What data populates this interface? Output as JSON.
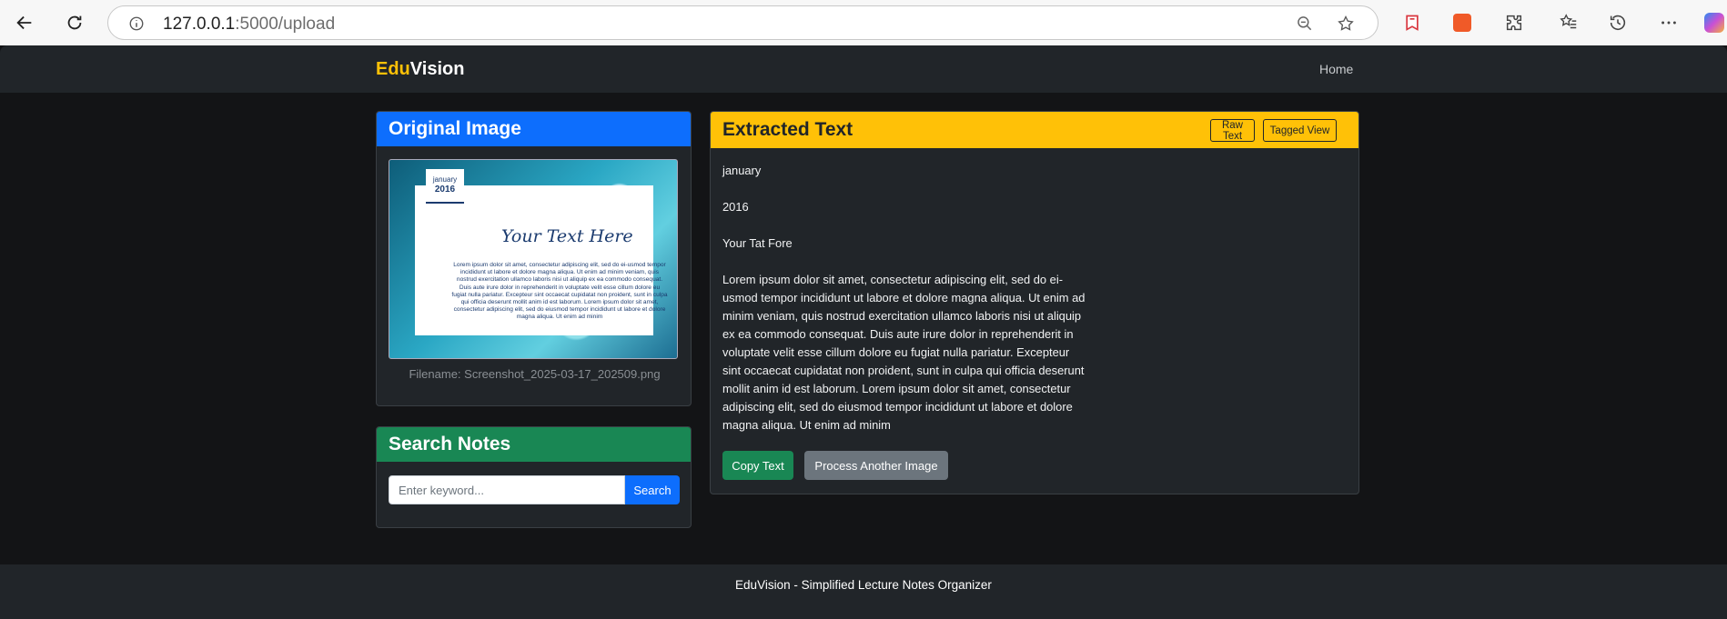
{
  "browser": {
    "url_host": "127.0.0.1",
    "url_path": ":5000/upload"
  },
  "nav": {
    "brand_part1": "Edu",
    "brand_part2": "Vision",
    "home": "Home"
  },
  "original": {
    "title": "Original Image",
    "filename": "Filename: Screenshot_2025-03-17_202509.png",
    "thumb": {
      "month": "january",
      "year": "2016",
      "title": "Your Text Here",
      "body": "Lorem ipsum dolor sit amet, consectetur adipiscing elit, sed do ei-usmod tempor incididunt ut labore et dolore magna aliqua. Ut enim ad minim veniam, quis nostrud exercitation ullamco laboris nisi ut aliquip ex ea commodo consequat. Duis aute irure dolor in reprehenderit in voluptate velit esse cillum dolore eu fugiat nulla pariatur. Excepteur sint occaecat cupidatat non proident, sunt in culpa qui officia deserunt mollit anim id est laborum. Lorem ipsum dolor sit amet, consectetur adipiscing elit, sed do eiusmod tempor incididunt ut labore et dolore magna aliqua. Ut enim ad minim"
    }
  },
  "search": {
    "title": "Search Notes",
    "placeholder": "Enter keyword...",
    "button": "Search"
  },
  "extracted": {
    "title": "Extracted Text",
    "raw_btn": "Raw Text",
    "tagged_btn": "Tagged View",
    "lines": [
      "january",
      "2016",
      "Your Tat Fore",
      "Lorem ipsum dolor sit amet, consectetur adipiscing elit, sed do ei-usmod tempor incididunt ut labore et dolore magna aliqua. Ut enim ad minim veniam, quis nostrud exercitation ullamco laboris nisi ut aliquip ex ea commodo consequat. Duis aute irure dolor in reprehenderit in voluptate velit esse cillum dolore eu fugiat nulla pariatur. Excepteur sint occaecat cupidatat non proident, sunt in culpa qui officia deserunt mollit anim id est laborum. Lorem ipsum dolor sit amet, consectetur adipiscing elit, sed do eiusmod tempor incididunt ut labore et dolore magna aliqua. Ut enim ad minim"
    ],
    "copy_btn": "Copy Text",
    "process_btn": "Process Another Image"
  },
  "footer": {
    "text": "EduVision - Simplified Lecture Notes Organizer"
  },
  "colors": {
    "primary": "#0d6efd",
    "success": "#198754",
    "warning": "#ffc107",
    "dark": "#212529"
  }
}
